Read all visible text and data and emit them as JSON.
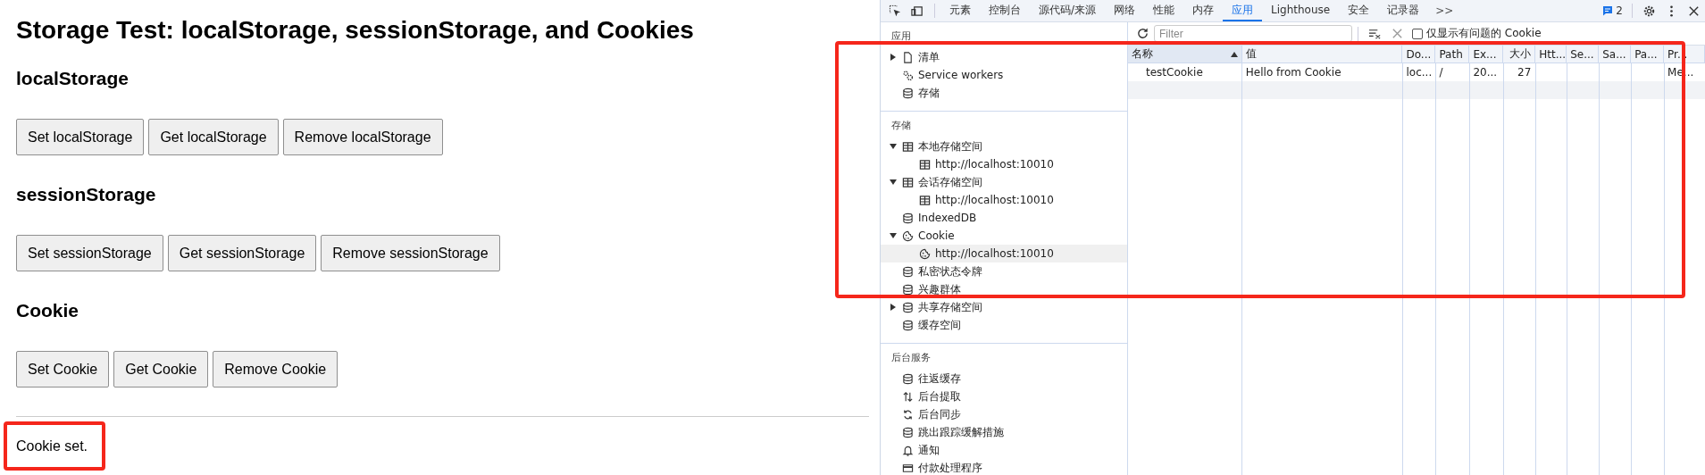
{
  "page": {
    "title": "Storage Test: localStorage, sessionStorage, and Cookies",
    "sections": [
      {
        "heading": "localStorage",
        "buttons": [
          "Set localStorage",
          "Get localStorage",
          "Remove localStorage"
        ]
      },
      {
        "heading": "sessionStorage",
        "buttons": [
          "Set sessionStorage",
          "Get sessionStorage",
          "Remove sessionStorage"
        ]
      },
      {
        "heading": "Cookie",
        "buttons": [
          "Set Cookie",
          "Get Cookie",
          "Remove Cookie"
        ]
      }
    ],
    "status": {
      "text": "Cookie set.",
      "highlighted": true
    }
  },
  "devtools": {
    "tabs": [
      {
        "label": "元素",
        "selected": false
      },
      {
        "label": "控制台",
        "selected": false
      },
      {
        "label": "源代码/来源",
        "selected": false
      },
      {
        "label": "网络",
        "selected": false
      },
      {
        "label": "性能",
        "selected": false
      },
      {
        "label": "内存",
        "selected": false
      },
      {
        "label": "应用",
        "selected": true
      },
      {
        "label": "Lighthouse",
        "selected": false
      },
      {
        "label": "安全",
        "selected": false
      },
      {
        "label": "记录器",
        "selected": false
      }
    ],
    "more_tabs": ">>",
    "issues_count": "2",
    "sidebar": [
      {
        "title": "应用",
        "items": [
          {
            "label": "清单",
            "kind": "file",
            "expanded": false,
            "selected": false
          },
          {
            "label": "Service workers",
            "kind": "gears",
            "selected": false
          },
          {
            "label": "存储",
            "kind": "database",
            "selected": false
          }
        ]
      },
      {
        "title": "存储",
        "items": [
          {
            "label": "本地存储空间",
            "kind": "table",
            "expanded": true,
            "selected": false,
            "children": [
              {
                "label": "http://localhost:10010",
                "kind": "table",
                "selected": false
              }
            ]
          },
          {
            "label": "会话存储空间",
            "kind": "table",
            "expanded": true,
            "selected": false,
            "children": [
              {
                "label": "http://localhost:10010",
                "kind": "table",
                "selected": false
              }
            ]
          },
          {
            "label": "IndexedDB",
            "kind": "database",
            "selected": false
          },
          {
            "label": "Cookie",
            "kind": "cookie",
            "expanded": true,
            "selected": false,
            "children": [
              {
                "label": "http://localhost:10010",
                "kind": "cookie",
                "selected": true
              }
            ]
          },
          {
            "label": "私密状态令牌",
            "kind": "database",
            "selected": false
          },
          {
            "label": "兴趣群体",
            "kind": "database",
            "selected": false
          },
          {
            "label": "共享存储空间",
            "kind": "database",
            "expanded": false,
            "selected": false
          },
          {
            "label": "缓存空间",
            "kind": "database",
            "selected": false
          }
        ]
      },
      {
        "title": "后台服务",
        "items": [
          {
            "label": "往返缓存",
            "kind": "database",
            "selected": false
          },
          {
            "label": "后台提取",
            "kind": "arrows",
            "selected": false
          },
          {
            "label": "后台同步",
            "kind": "sync",
            "selected": false
          },
          {
            "label": "跳出跟踪缓解措施",
            "kind": "database",
            "selected": false
          },
          {
            "label": "通知",
            "kind": "bell",
            "selected": false
          },
          {
            "label": "付款处理程序",
            "kind": "card",
            "selected": false
          }
        ]
      }
    ],
    "filter": {
      "placeholder": "Filter",
      "only_issues": {
        "label": "仅显示有问题的 Cookie",
        "checked": false
      }
    },
    "table": {
      "highlighted": true,
      "columns": [
        {
          "label": "名称",
          "sorted": true
        },
        {
          "label": "值",
          "sorted": false
        },
        {
          "label": "Do...",
          "sorted": false
        },
        {
          "label": "Path",
          "sorted": false
        },
        {
          "label": "Ex...",
          "sorted": false
        },
        {
          "label": "大小",
          "sorted": false
        },
        {
          "label": "Htt...",
          "sorted": false
        },
        {
          "label": "Se...",
          "sorted": false
        },
        {
          "label": "Sa...",
          "sorted": false
        },
        {
          "label": "Pa...",
          "sorted": false
        },
        {
          "label": "Pr...",
          "sorted": false
        }
      ],
      "rows": [
        {
          "selected": false,
          "cells": [
            "testCookie",
            "Hello from Cookie",
            "loc...",
            "/",
            "20...",
            "27",
            null,
            null,
            null,
            null,
            "Me..."
          ]
        }
      ]
    }
  }
}
